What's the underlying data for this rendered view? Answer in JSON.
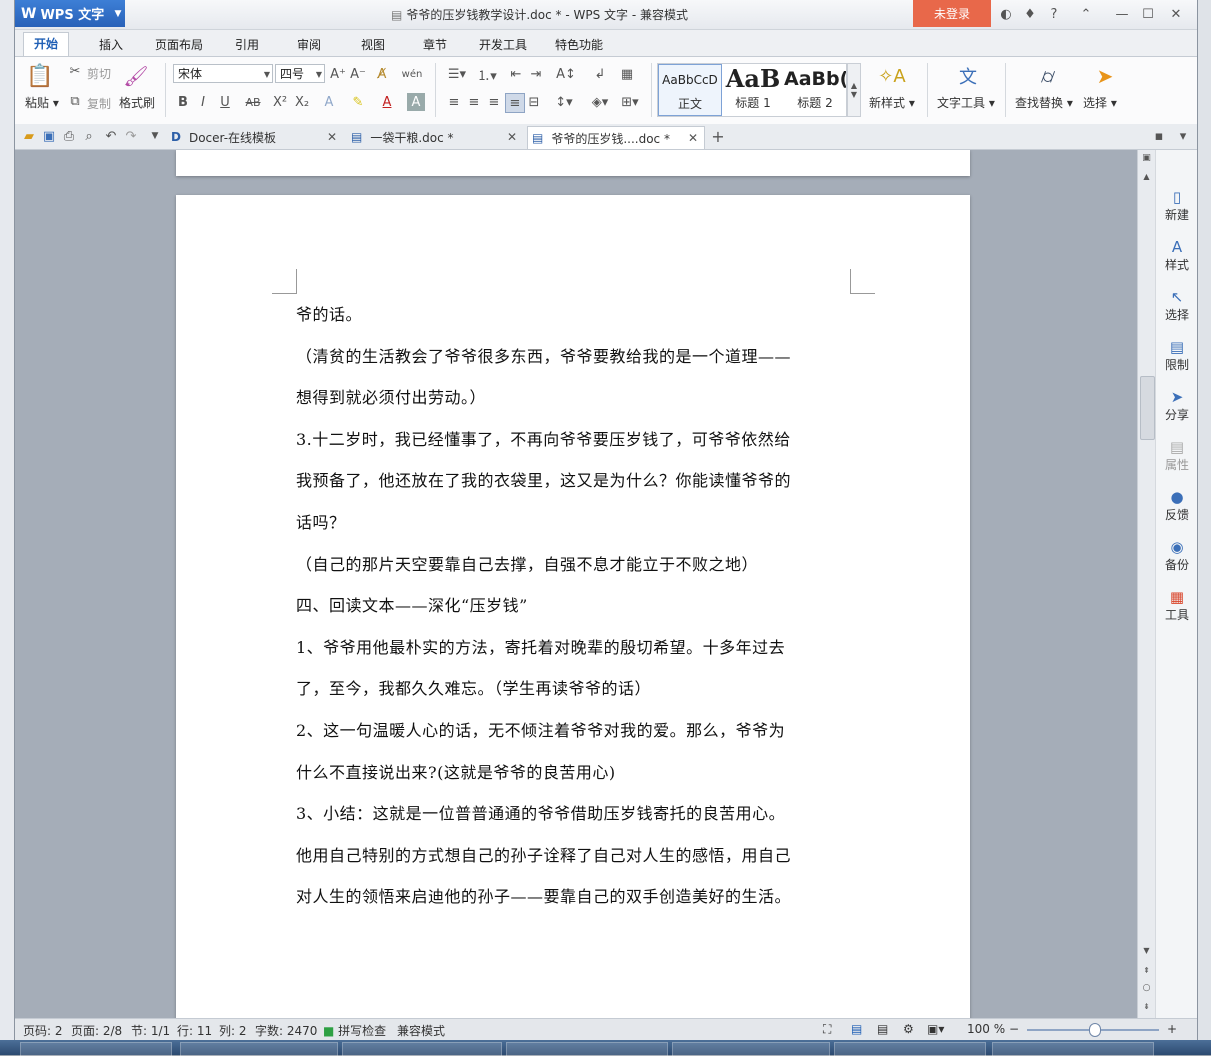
{
  "app": {
    "name": "WPS 文字",
    "title": "爷爷的压岁钱教学设计.doc * - WPS 文字 - 兼容模式",
    "login": "未登录"
  },
  "ribbon_tabs": [
    "开始",
    "插入",
    "页面布局",
    "引用",
    "审阅",
    "视图",
    "章节",
    "开发工具",
    "特色功能"
  ],
  "ribbon": {
    "paste": "粘贴",
    "cut": "剪切",
    "copy": "复制",
    "format_painter": "格式刷",
    "font_name": "宋体",
    "font_size": "四号",
    "styles": [
      {
        "preview": "AaBbCcD",
        "name": "正文"
      },
      {
        "preview": "AaB",
        "name": "标题 1"
      },
      {
        "preview": "AaBb(",
        "name": "标题 2"
      }
    ],
    "new_style": "新样式",
    "text_tools": "文字工具",
    "find_replace": "查找替换",
    "select": "选择"
  },
  "doc_tabs": [
    {
      "label": "Docer-在线模板"
    },
    {
      "label": "一袋干粮.doc *"
    },
    {
      "label": "爷爷的压岁钱....doc *"
    }
  ],
  "document": {
    "lines": [
      "爷的话。",
      "（清贫的生活教会了爷爷很多东西，爷爷要教给我的是一个道理——",
      "想得到就必须付出劳动。）",
      "3.十二岁时，我已经懂事了，不再向爷爷要压岁钱了，可爷爷依然给",
      "我预备了，他还放在了我的衣袋里，这又是为什么？你能读懂爷爷的",
      "话吗？",
      "（自己的那片天空要靠自己去撑，自强不息才能立于不败之地）",
      "四、回读文本——深化“压岁钱”",
      "1、爷爷用他最朴实的方法，寄托着对晚辈的殷切希望。十多年过去",
      "了，至今，我都久久难忘。（学生再读爷爷的话）",
      "2、这一句温暖人心的话，无不倾注着爷爷对我的爱。那么，爷爷为",
      "什么不直接说出来?(这就是爷爷的良苦用心)",
      "3、小结：这就是一位普普通通的爷爷借助压岁钱寄托的良苦用心。",
      "他用自己特别的方式想自己的孙子诠释了自己对人生的感悟，用自己",
      "对人生的领悟来启迪他的孙子——要靠自己的双手创造美好的生活。"
    ]
  },
  "side_panel": [
    "新建",
    "样式",
    "选择",
    "限制",
    "分享",
    "属性",
    "反馈",
    "备份",
    "工具"
  ],
  "status": {
    "page_code": "页码: 2",
    "pages": "页面: 2/8",
    "section": "节: 1/1",
    "row": "行: 11",
    "col": "列: 2",
    "word_count": "字数: 2470",
    "spell_check": "拼写检查",
    "compat_mode": "兼容模式",
    "zoom": "100 %"
  },
  "colors": {
    "accent": "#2861b8",
    "login": "#e8684a"
  }
}
